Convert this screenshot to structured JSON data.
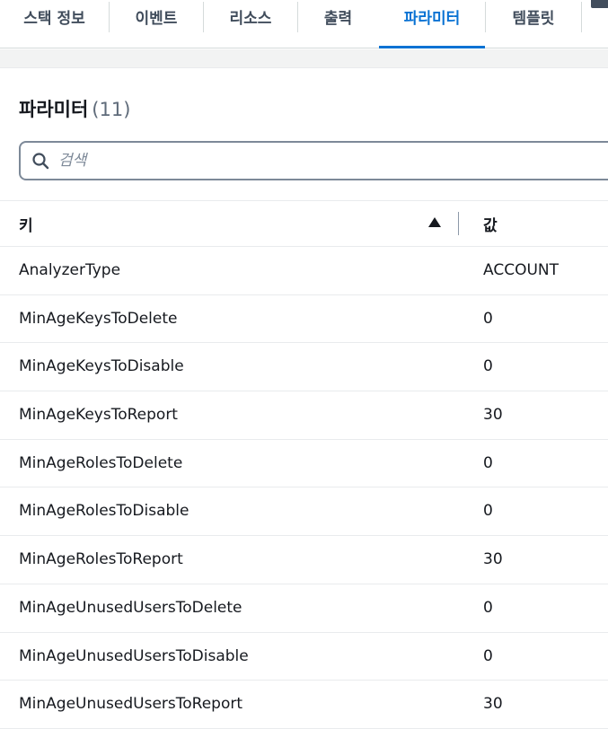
{
  "tabs": [
    {
      "label": "스택 정보",
      "active": false
    },
    {
      "label": "이벤트",
      "active": false
    },
    {
      "label": "리소스",
      "active": false
    },
    {
      "label": "출력",
      "active": false
    },
    {
      "label": "파라미터",
      "active": true
    },
    {
      "label": "템플릿",
      "active": false
    }
  ],
  "panel": {
    "title": "파라미터",
    "count": "(11)"
  },
  "search": {
    "placeholder": "검색",
    "value": "",
    "icon": "search-icon"
  },
  "table": {
    "columns": {
      "key": "키",
      "value": "값"
    },
    "sort": {
      "column": "key",
      "direction": "ascending",
      "icon": "sort-ascending-icon"
    },
    "rows": [
      {
        "key": "AnalyzerType",
        "value": "ACCOUNT"
      },
      {
        "key": "MinAgeKeysToDelete",
        "value": "0"
      },
      {
        "key": "MinAgeKeysToDisable",
        "value": "0"
      },
      {
        "key": "MinAgeKeysToReport",
        "value": "30"
      },
      {
        "key": "MinAgeRolesToDelete",
        "value": "0"
      },
      {
        "key": "MinAgeRolesToDisable",
        "value": "0"
      },
      {
        "key": "MinAgeRolesToReport",
        "value": "30"
      },
      {
        "key": "MinAgeUnusedUsersToDelete",
        "value": "0"
      },
      {
        "key": "MinAgeUnusedUsersToDisable",
        "value": "0"
      },
      {
        "key": "MinAgeUnusedUsersToReport",
        "value": "30"
      }
    ]
  },
  "colors": {
    "accent": "#0972d3",
    "text": "#16191f",
    "tab_text": "#414d5c",
    "divider": "#e9ebed",
    "band": "#f2f3f3"
  }
}
